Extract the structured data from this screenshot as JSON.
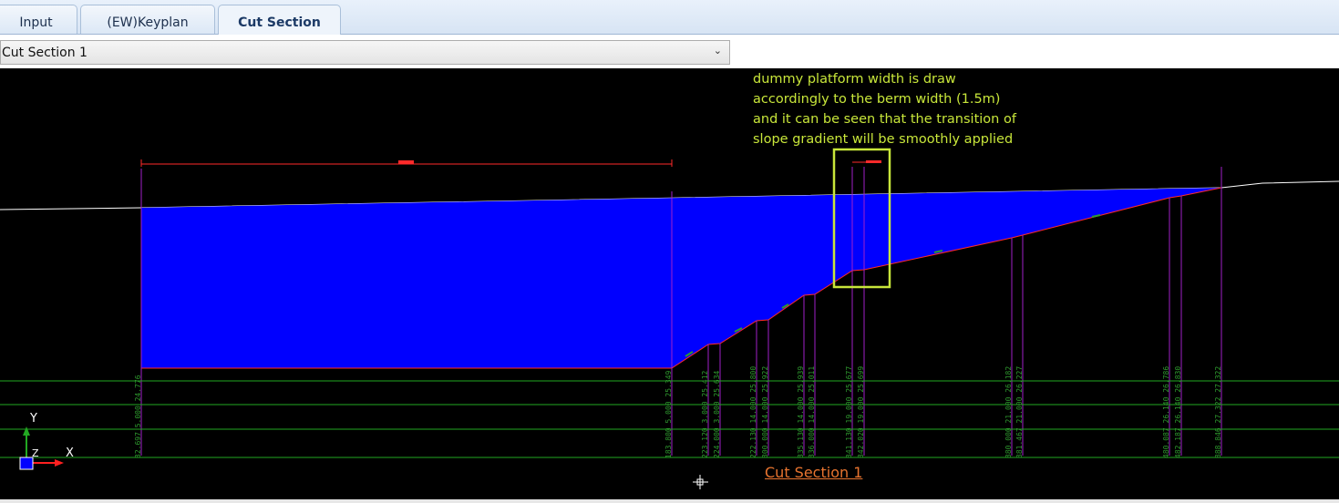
{
  "tabs": [
    {
      "label": "Input",
      "active": false
    },
    {
      "label": "(EW)Keyplan",
      "active": false
    },
    {
      "label": "Cut Section",
      "active": true
    }
  ],
  "section_selector": {
    "selected": "Cut Section 1"
  },
  "drawing": {
    "background": "#000000",
    "fill_color": "#0000ff",
    "profile_color": "#ff2a2a",
    "ground_line_color": "#ffffff",
    "station_line_color": "#a020c8",
    "grid_line_color": "#22a822",
    "note_color": "#c8e63a",
    "annotation_text": "dummy platform width is draw\naccordingly to the berm width (1.5m)\nand it can be seen that the transition of\nslope gradient will be smoothly applied",
    "caption": "Cut Section 1",
    "ucs": {
      "x": "X",
      "y": "Y",
      "z": "Z"
    },
    "station_labels": [
      "32.697  5.000  24.776",
      "183.800  5.000  25.349",
      "223.120  3.000  25.412",
      "224.000  3.000  25.634",
      "222.130  14.000  25.800",
      "300.000  14.000  25.922",
      "335.130  14.000  25.939",
      "336.000  14.000  25.011",
      "341.130  19.000  25.677",
      "342.020  19.000  25.699",
      "380.000  21.000  26.182",
      "381.467  21.000  26.227",
      "480.087  26.140  26.786",
      "482.187  26.140  26.830",
      "888.846  27.322  27.322"
    ]
  }
}
